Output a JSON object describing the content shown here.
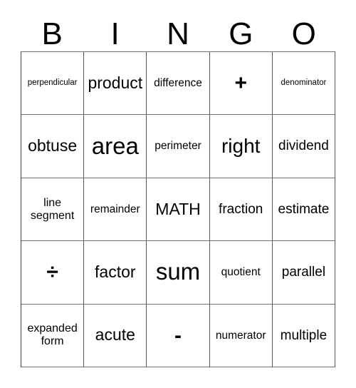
{
  "card": {
    "title_letters": [
      "B",
      "I",
      "N",
      "G",
      "O"
    ],
    "columns": 5,
    "rows": 5,
    "colors": {
      "background": "#ffffff",
      "text": "#000000",
      "grid_line": "#555555"
    },
    "cells": [
      [
        {
          "text": "perpendicular",
          "size": "xs"
        },
        {
          "text": "product",
          "size": "lg"
        },
        {
          "text": "difference",
          "size": "sm"
        },
        {
          "text": "+",
          "size": "sym"
        },
        {
          "text": "denominator",
          "size": "xs"
        }
      ],
      [
        {
          "text": "obtuse",
          "size": "lg"
        },
        {
          "text": "area",
          "size": "xxl"
        },
        {
          "text": "perimeter",
          "size": "sm"
        },
        {
          "text": "right",
          "size": "xl"
        },
        {
          "text": "dividend",
          "size": "md"
        }
      ],
      [
        {
          "text": "line segment",
          "size": "two-line"
        },
        {
          "text": "remainder",
          "size": "sm"
        },
        {
          "text": "MATH",
          "size": "lg"
        },
        {
          "text": "fraction",
          "size": "md"
        },
        {
          "text": "estimate",
          "size": "md"
        }
      ],
      [
        {
          "text": "÷",
          "size": "sym"
        },
        {
          "text": "factor",
          "size": "lg"
        },
        {
          "text": "sum",
          "size": "xxl"
        },
        {
          "text": "quotient",
          "size": "sm"
        },
        {
          "text": "parallel",
          "size": "md"
        }
      ],
      [
        {
          "text": "expanded form",
          "size": "two-line"
        },
        {
          "text": "acute",
          "size": "lg"
        },
        {
          "text": "-",
          "size": "sym-minus"
        },
        {
          "text": "numerator",
          "size": "sm"
        },
        {
          "text": "multiple",
          "size": "md"
        }
      ]
    ]
  }
}
